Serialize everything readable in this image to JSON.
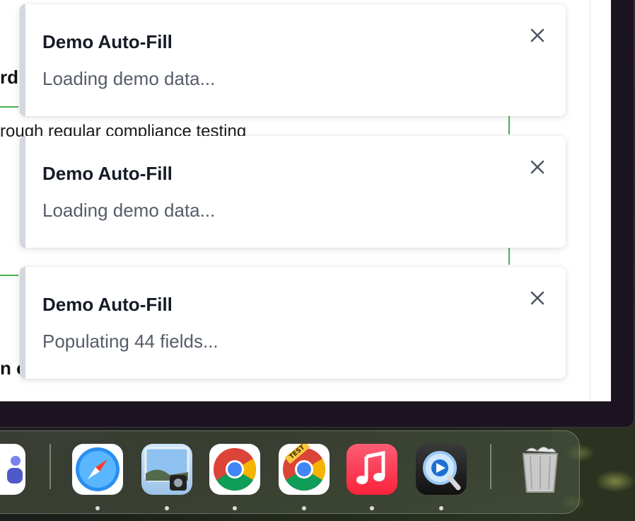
{
  "background_page": {
    "heading_fragment": "rd",
    "body_fragment": "rough regular compliance testing",
    "footer_fragment": "n c"
  },
  "toasts": [
    {
      "title": "Demo Auto-Fill",
      "message": "Loading demo data...",
      "accent": "#d3d7de"
    },
    {
      "title": "Demo Auto-Fill",
      "message": "Loading demo data...",
      "accent": "#d3d7de"
    },
    {
      "title": "Demo Auto-Fill",
      "message": "Populating 44 fields...",
      "accent": "#d3d7de"
    }
  ],
  "dock": {
    "apps": [
      {
        "name": "Microsoft Teams",
        "icon": "teams-icon",
        "running": false
      },
      {
        "name": "Safari",
        "icon": "safari-icon",
        "running": true
      },
      {
        "name": "Preview",
        "icon": "preview-icon",
        "running": true
      },
      {
        "name": "Google Chrome",
        "icon": "chrome-icon",
        "running": true
      },
      {
        "name": "Google Chrome for Testing",
        "icon": "chrome-test-icon",
        "badge": "TEST",
        "running": true
      },
      {
        "name": "Music",
        "icon": "music-icon",
        "running": true
      },
      {
        "name": "QuickTime Player",
        "icon": "quicktime-icon",
        "running": true
      },
      {
        "name": "Trash",
        "icon": "trash-icon",
        "running": false
      }
    ]
  },
  "colors": {
    "toast_title": "#151b26",
    "toast_message": "#565d69",
    "accent_green": "#48b34f"
  }
}
